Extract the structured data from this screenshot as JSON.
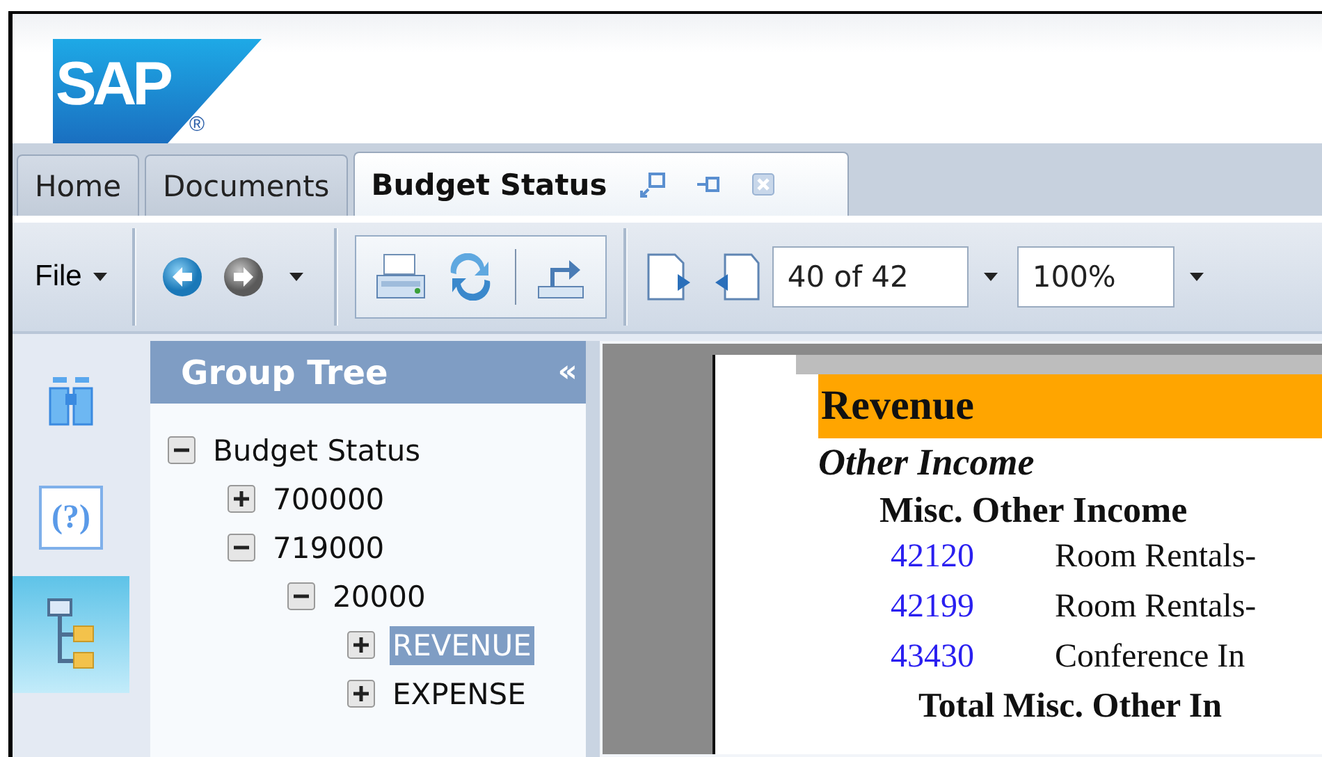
{
  "logo": {
    "text": "SAP",
    "mark": "®"
  },
  "tabs": [
    {
      "label": "Home",
      "selected": false
    },
    {
      "label": "Documents",
      "selected": false
    },
    {
      "label": "Budget Status",
      "selected": true
    }
  ],
  "toolbar": {
    "file_menu": "File",
    "page_field": {
      "value": "40 of 42"
    },
    "zoom_field": {
      "value": "100%"
    }
  },
  "rail": [
    {
      "kind": "search",
      "selected": false
    },
    {
      "kind": "help",
      "selected": false,
      "glyph": "(?)"
    },
    {
      "kind": "tree",
      "selected": true
    }
  ],
  "group_tree": {
    "title": "Group Tree",
    "collapse": "«",
    "nodes": [
      {
        "label": "Budget Status",
        "expanded": true,
        "selected": false,
        "children": [
          {
            "label": "700000",
            "expanded": false,
            "selected": false
          },
          {
            "label": "719000",
            "expanded": true,
            "selected": false,
            "children": [
              {
                "label": "20000",
                "expanded": true,
                "selected": false,
                "children": [
                  {
                    "label": "REVENUE",
                    "expanded": false,
                    "selected": true
                  },
                  {
                    "label": "EXPENSE",
                    "expanded": false,
                    "selected": false
                  }
                ]
              }
            ]
          }
        ]
      }
    ]
  },
  "report": {
    "section": "Revenue",
    "group": "Other Income",
    "subgroup": "Misc. Other Income",
    "rows": [
      {
        "code": "42120",
        "description": "Room Rentals-"
      },
      {
        "code": "42199",
        "description": "Room Rentals-"
      },
      {
        "code": "43430",
        "description": "Conference In"
      }
    ],
    "total": "Total Misc. Other In"
  }
}
